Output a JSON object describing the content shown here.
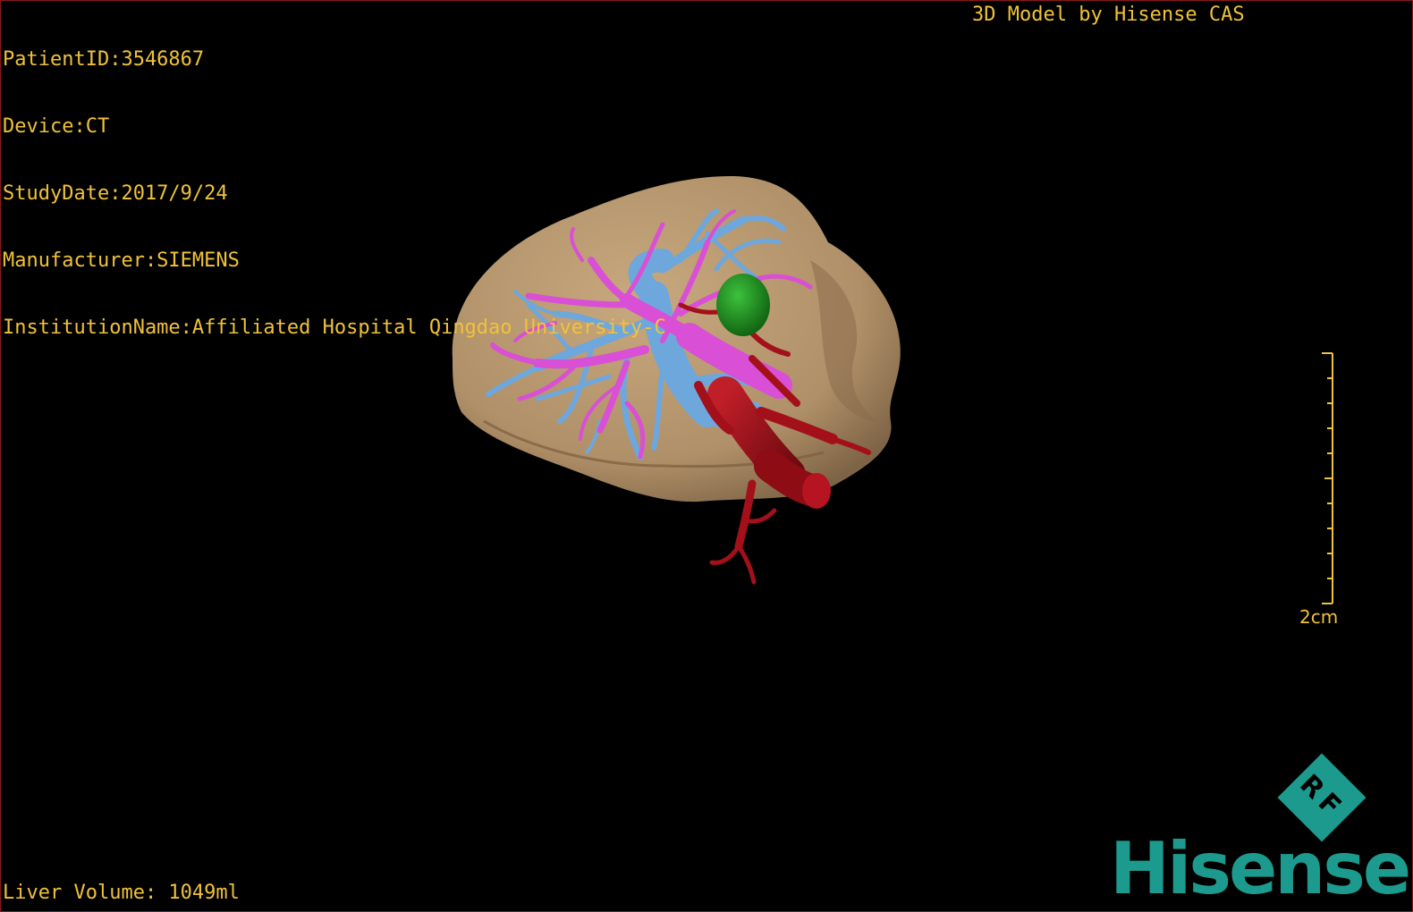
{
  "patient_info": {
    "patient_id": "PatientID:3546867",
    "device": "Device:CT",
    "study_date": "StudyDate:2017/9/24",
    "manufacturer": "Manufacturer:SIEMENS",
    "institution": "InstitutionName:Affiliated Hospital Qingdao University-C"
  },
  "model_credit": "3D Model by Hisense CAS",
  "liver_volume": "Liver Volume: 1049ml",
  "scale": {
    "label": "2cm"
  },
  "brand": {
    "badge_text": "RF",
    "logo_text": "Hisense",
    "color": "#1c9a8e"
  },
  "colors": {
    "overlay_text": "#f0c23a",
    "liver": "#b89870",
    "portal_vein": "#d94fd6",
    "hepatic_vein": "#6ea7dc",
    "artery": "#a3101a",
    "lesion": "#1f9a1f",
    "frame_border": "#8b1a1a"
  }
}
